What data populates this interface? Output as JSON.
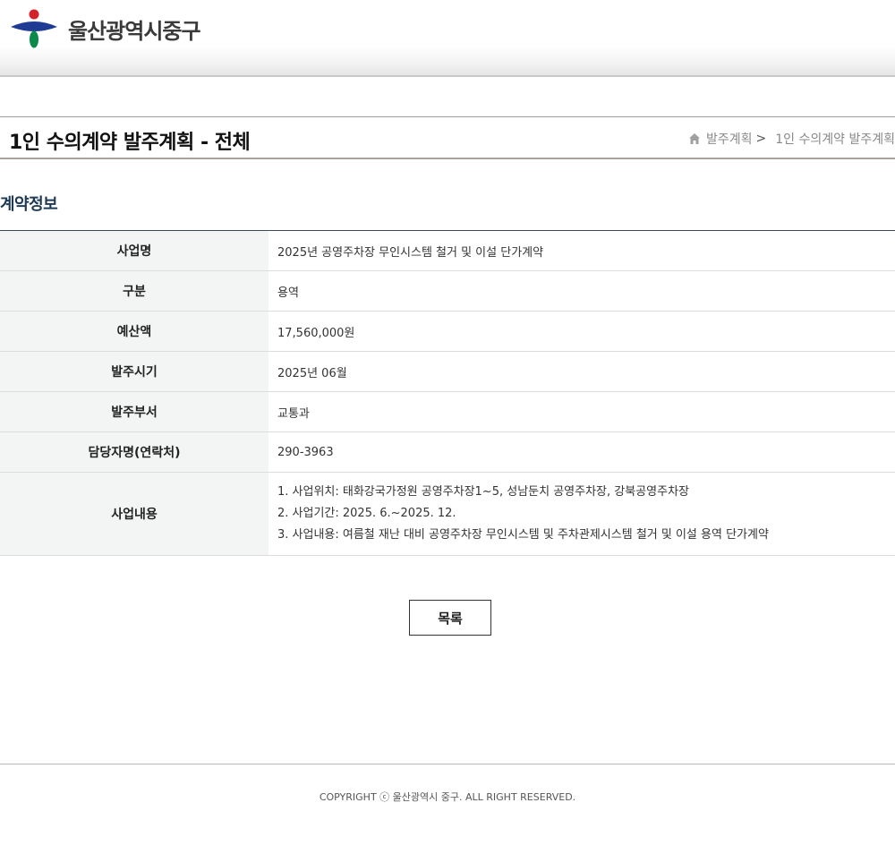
{
  "header": {
    "logo_text": "울산광역시중구",
    "brand_colors": {
      "red": "#d6202a",
      "blue": "#1f3b93",
      "green": "#0a8a4a"
    }
  },
  "title_bar": {
    "title": "1인 수의계약 발주계획 - 전체",
    "breadcrumb": {
      "home_icon": "home-icon",
      "item1": "발주계획",
      "separator": ">",
      "item2": "1인 수의계약 발주계획"
    }
  },
  "section": {
    "title": "계약정보"
  },
  "table": {
    "rows": [
      {
        "label": "사업명",
        "value": "2025년 공영주차장 무인시스템 철거 및 이설 단가계약"
      },
      {
        "label": "구분",
        "value": "용역"
      },
      {
        "label": "예산액",
        "value": "17,560,000원"
      },
      {
        "label": "발주시기",
        "value": "2025년 06월"
      },
      {
        "label": "발주부서",
        "value": "교통과"
      },
      {
        "label": "담당자명(연락처)",
        "value": "290-3963"
      }
    ],
    "content": {
      "label": "사업내용",
      "lines": [
        "1. 사업위치: 태화강국가정원 공영주차장1~5, 성남둔치 공영주차장, 강북공영주차장",
        "2. 사업기간: 2025. 6.~2025. 12.",
        "3. 사업내용: 여름철 재난 대비 공영주차장 무인시스템 및 주차관제시스템 철거 및 이설 용역 단가계약"
      ]
    }
  },
  "buttons": {
    "list_label": "목록"
  },
  "footer": {
    "copyright": "COPYRIGHT ⓒ 울산광역시 중구. ALL RIGHT RESERVED."
  }
}
